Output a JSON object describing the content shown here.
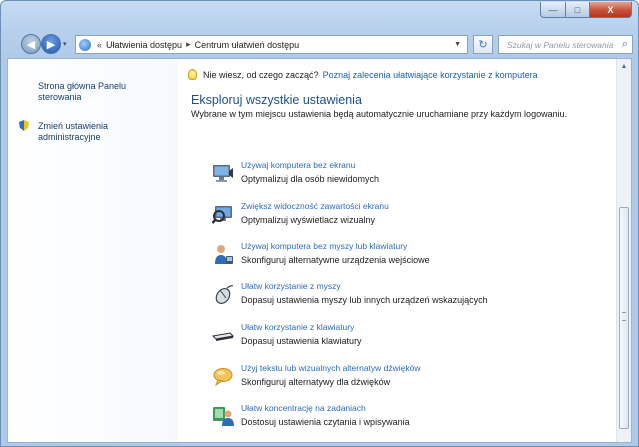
{
  "window": {
    "min_glyph": "—",
    "max_glyph": "□",
    "close_glyph": "X"
  },
  "nav": {
    "back_glyph": "◀",
    "forward_glyph": "▶",
    "history_glyph": "▾",
    "breadcrumb": [
      "«",
      "Ułatwienia dostępu",
      "▸",
      "Centrum ułatwień dostępu"
    ],
    "address_drop": "▼",
    "refresh_glyph": "↻",
    "search_placeholder": "Szukaj w Panelu sterowania",
    "search_icon_glyph": "⌕"
  },
  "sidebar": {
    "home_link": [
      "Strona główna Panelu",
      "sterowania"
    ],
    "admin_link": [
      "Zmień ustawienia",
      "administracyjne"
    ]
  },
  "main": {
    "tip_text": "Nie wiesz, od czego zacząć?",
    "tip_link": "Poznaj zalecenia ułatwiające korzystanie z komputera",
    "heading": "Eksploruj wszystkie ustawienia",
    "description": "Wybrane w tym miejscu ustawienia będą automatycznie uruchamiane przy każdym logowaniu.",
    "items": [
      {
        "title": "Używaj komputera bez ekranu",
        "sub": "Optymalizuj dla osób niewidomych",
        "icon": "monitor-speaker-icon"
      },
      {
        "title": "Zwiększ widoczność zawartości ekranu",
        "sub": "Optymalizuj wyświetlacz wizualny",
        "icon": "magnifier-monitor-icon"
      },
      {
        "title": "Używaj komputera bez myszy lub klawiatury",
        "sub": "Skonfiguruj alternatywne urządzenia wejściowe",
        "icon": "user-device-icon"
      },
      {
        "title": "Ułatw korzystanie z myszy",
        "sub": "Dopasuj ustawienia myszy lub innych urządzeń wskazujących",
        "icon": "mouse-icon"
      },
      {
        "title": "Ułatw korzystanie z klawiatury",
        "sub": "Dopasuj ustawienia klawiatury",
        "icon": "keyboard-icon"
      },
      {
        "title": "Użyj tekstu lub wizualnych alternatyw dźwięków",
        "sub": "Skonfiguruj alternatywy dla dźwięków",
        "icon": "speech-bubble-icon"
      },
      {
        "title": "Ułatw koncentrację na zadaniach",
        "sub": "Dostosuj ustawienia czytania i wpisywania",
        "icon": "focus-tasks-icon"
      }
    ]
  },
  "scroll": {
    "up_glyph": "▲"
  }
}
